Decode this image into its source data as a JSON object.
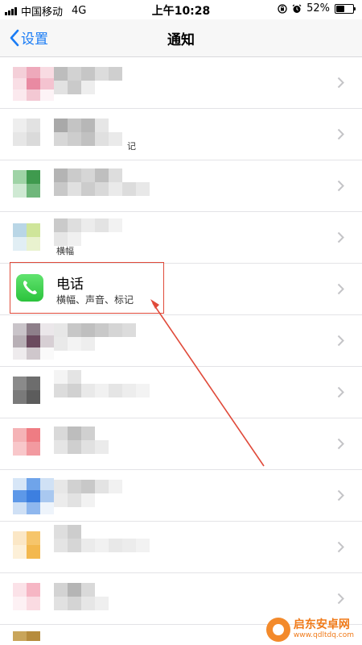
{
  "status_bar": {
    "carrier": "中国移动",
    "network": "4G",
    "time": "上午10:28",
    "battery": "52%",
    "battery_level": 0.52
  },
  "nav": {
    "back_label": "设置",
    "title": "通知"
  },
  "rows": [
    {
      "title": "",
      "subtitle": "",
      "stray": ""
    },
    {
      "title": "",
      "subtitle": "",
      "stray": "记"
    },
    {
      "title": "",
      "subtitle": "",
      "stray": ""
    },
    {
      "title": "",
      "subtitle": "",
      "stray": "横幅"
    },
    {
      "title": "电话",
      "subtitle": "横幅、声音、标记",
      "stray": ""
    },
    {
      "title": "",
      "subtitle": "",
      "stray": ""
    },
    {
      "title": "",
      "subtitle": "",
      "stray": ""
    },
    {
      "title": "",
      "subtitle": "",
      "stray": ""
    },
    {
      "title": "",
      "subtitle": "",
      "stray": ""
    },
    {
      "title": "",
      "subtitle": "",
      "stray": ""
    },
    {
      "title": "",
      "subtitle": "",
      "stray": ""
    }
  ],
  "icons": {
    "back": "chevron-left-icon",
    "row_disclosure": "chevron-right-icon",
    "phone_app": "phone-icon"
  },
  "colors": {
    "accent": "#1a7cf5",
    "phone_green": "#34c759",
    "highlight": "#e04a3a",
    "watermark": "#f07a19"
  },
  "watermark": {
    "title": "启东安卓网",
    "url": "www.qdltdq.com"
  }
}
